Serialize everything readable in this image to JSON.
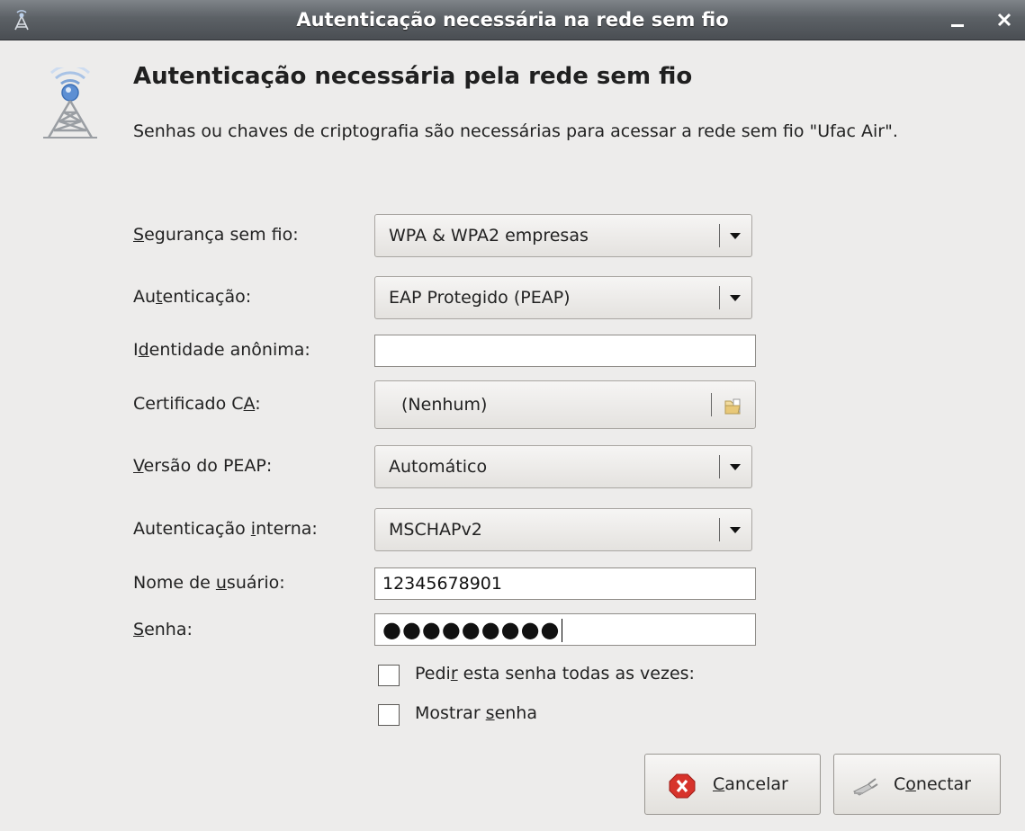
{
  "window": {
    "title": "Autenticação necessária na rede sem fio",
    "icons": [
      "wireless-icon",
      "minimize-icon",
      "close-icon"
    ]
  },
  "dialog": {
    "heading": "Autenticação necessária pela rede sem fio",
    "description": "Senhas ou chaves de criptografia são necessárias para acessar a rede sem fio \"Ufac Air\"."
  },
  "form": {
    "security": {
      "label_pre": "",
      "label_key": "S",
      "label_post": "egurança sem fio:",
      "value": "WPA & WPA2 empresas"
    },
    "authentication": {
      "label_pre": "Au",
      "label_key": "t",
      "label_post": "enticação:",
      "value": "EAP Protegido (PEAP)"
    },
    "anonymous_identity": {
      "label_pre": "I",
      "label_key": "d",
      "label_post": "entidade anônima:",
      "value": ""
    },
    "ca_certificate": {
      "label_pre": "Certificado C",
      "label_key": "A",
      "label_post": ":",
      "value": "(Nenhum)"
    },
    "peap_version": {
      "label_pre": "",
      "label_key": "V",
      "label_post": "ersão do PEAP:",
      "value": "Automático"
    },
    "inner_auth": {
      "label_pre": "Autenticação ",
      "label_key": "i",
      "label_post": "nterna:",
      "value": "MSCHAPv2"
    },
    "username": {
      "label_pre": "Nome de ",
      "label_key": "u",
      "label_post": "suário:",
      "value": "12345678901"
    },
    "password": {
      "label_pre": "",
      "label_key": "S",
      "label_post": "enha:",
      "value": "●●●●●●●●●"
    },
    "ask_every_time": {
      "label_pre": "Pedi",
      "label_key": "r",
      "label_post": " esta senha todas as vezes:",
      "checked": false
    },
    "show_password": {
      "label_pre": "Mostrar ",
      "label_key": "s",
      "label_post": "enha",
      "checked": false
    }
  },
  "buttons": {
    "cancel": {
      "label_pre": "",
      "label_key": "C",
      "label_post": "ancelar"
    },
    "connect": {
      "label_pre": "C",
      "label_key": "o",
      "label_post": "nectar"
    }
  },
  "colors": {
    "background": "#edeceb",
    "titlebar": "#5c6166",
    "cancel_icon": "#d7332b"
  }
}
